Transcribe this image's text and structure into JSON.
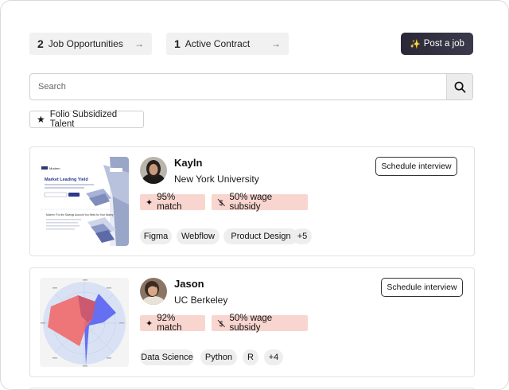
{
  "top": {
    "opportunities": {
      "count": "2",
      "label": "Job Opportunities",
      "arrow": "→"
    },
    "contracts": {
      "count": "1",
      "label": "Active Contract",
      "arrow": "→"
    },
    "post_job": {
      "icon": "✨",
      "label": "Post a job"
    }
  },
  "search": {
    "placeholder": "Search",
    "value": ""
  },
  "filter": {
    "icon": "★",
    "label": "Folio Subsidized Talent"
  },
  "candidates": [
    {
      "name": "Kayln",
      "school": "New York University",
      "schedule_label": "Schedule interview",
      "match_icon": "✦",
      "match": "95% match",
      "wage_icon": "💲",
      "wage": "50% wage subsidy",
      "skills": [
        "Figma",
        "Webflow",
        "Product Design",
        "+5"
      ],
      "thumbnail": {
        "kind": "website-mockup",
        "brand": "Modern",
        "headline": "Market Leading Yield",
        "tagline": "Modern FI is the Savings Account You Need for Your Money"
      }
    },
    {
      "name": "Jason",
      "school": "UC Berkeley",
      "schedule_label": "Schedule interview",
      "match_icon": "✦",
      "match": "92% match",
      "wage_icon": "💲",
      "wage": "50% wage subsidy",
      "skills": [
        "Data Science",
        "Python",
        "R",
        "+4"
      ],
      "thumbnail": {
        "kind": "radar-chart"
      }
    }
  ],
  "colors": {
    "accent_dark": "#2a2836",
    "badge_bg": "#f9d5cf",
    "chip_bg": "#eeeeee"
  }
}
